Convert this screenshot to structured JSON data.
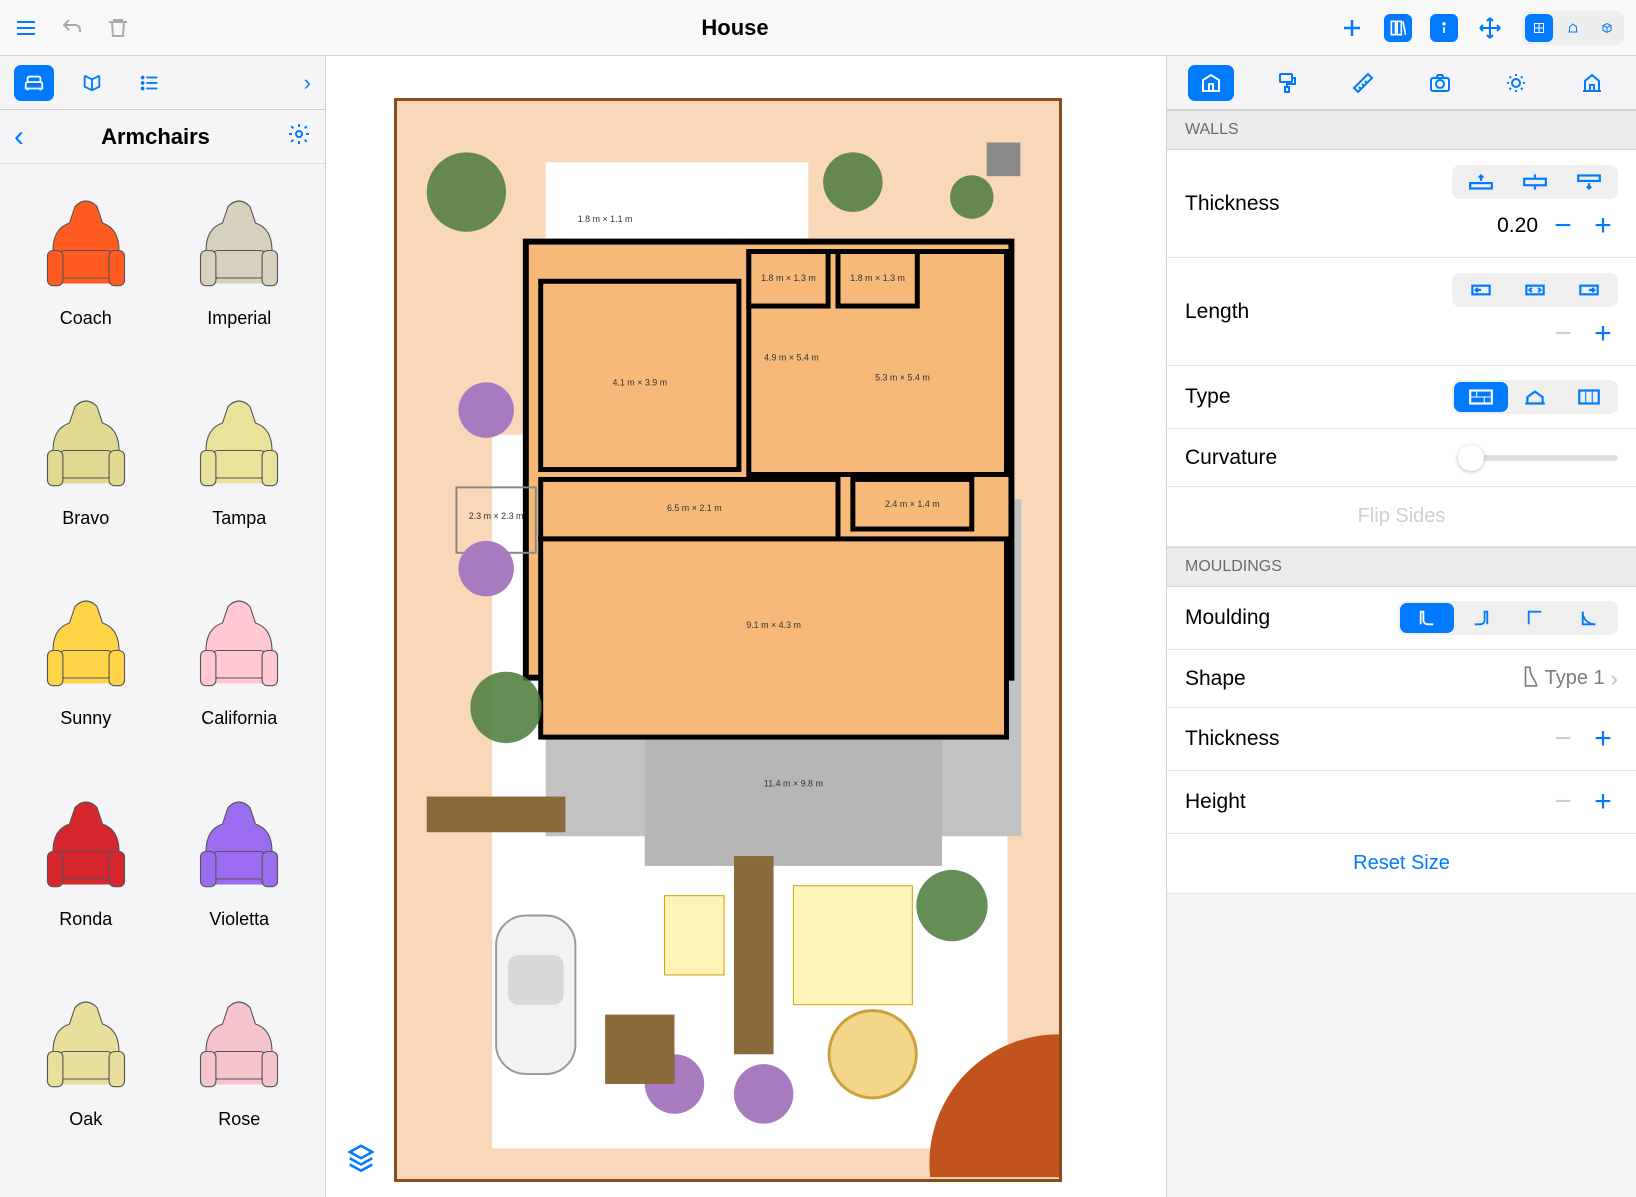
{
  "header": {
    "title": "House"
  },
  "sidebar": {
    "category_title": "Armchairs",
    "items": [
      {
        "label": "Coach",
        "color": "#ff5a1f"
      },
      {
        "label": "Imperial",
        "color": "#d6d0bc"
      },
      {
        "label": "Bravo",
        "color": "#e0d98f"
      },
      {
        "label": "Tampa",
        "color": "#e9e29a"
      },
      {
        "label": "Sunny",
        "color": "#ffd447"
      },
      {
        "label": "California",
        "color": "#ffc8d2"
      },
      {
        "label": "Ronda",
        "color": "#d6272e"
      },
      {
        "label": "Violetta",
        "color": "#9a6cf0"
      },
      {
        "label": "Oak",
        "color": "#e7df9b"
      },
      {
        "label": "Rose",
        "color": "#f5c4cc"
      }
    ]
  },
  "inspector": {
    "sections": {
      "walls": {
        "title": "WALLS",
        "thickness_label": "Thickness",
        "thickness_value": "0.20",
        "length_label": "Length",
        "type_label": "Type",
        "curvature_label": "Curvature",
        "flip_label": "Flip Sides"
      },
      "mouldings": {
        "title": "MOULDINGS",
        "moulding_label": "Moulding",
        "shape_label": "Shape",
        "shape_value": "Type 1",
        "thickness_label": "Thickness",
        "height_label": "Height",
        "reset_label": "Reset Size"
      }
    }
  },
  "floorplan": {
    "rooms": [
      {
        "dims": "1.8 m × 1.1 m"
      },
      {
        "dims": "1.8 m × 1.3 m"
      },
      {
        "dims": "1.8 m × 1.3 m"
      },
      {
        "dims": "4.1 m × 3.9 m"
      },
      {
        "dims": "4.9 m × 5.4 m"
      },
      {
        "dims": "5.3 m × 5.4 m"
      },
      {
        "dims": "2.3 m × 2.3 m"
      },
      {
        "dims": "6.5 m × 2.1 m"
      },
      {
        "dims": "2.4 m × 1.4 m"
      },
      {
        "dims": "9.1 m × 4.3 m"
      },
      {
        "dims": "11.4 m × 9.8 m"
      }
    ]
  }
}
